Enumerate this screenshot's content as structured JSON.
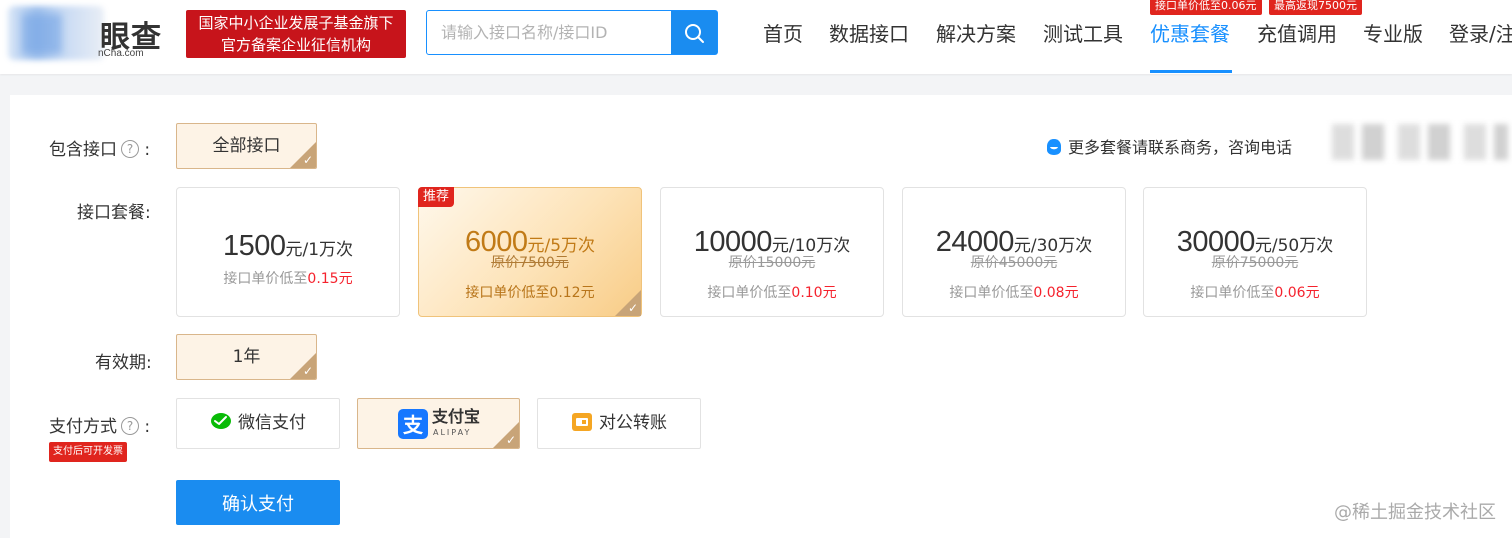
{
  "header": {
    "logo": {
      "name": "眼查",
      "domain": "nCha.com"
    },
    "gov_badge": {
      "line1": "国家中小企业发展子基金旗下",
      "line2": "官方备案企业征信机构"
    },
    "search": {
      "placeholder": "请输入接口名称/接口ID",
      "value": ""
    },
    "nav": [
      {
        "label": "首页"
      },
      {
        "label": "数据接口"
      },
      {
        "label": "解决方案"
      },
      {
        "label": "测试工具"
      },
      {
        "label": "优惠套餐",
        "active": true
      },
      {
        "label": "充值调用"
      },
      {
        "label": "专业版"
      },
      {
        "label": "登录/注"
      }
    ],
    "nav_tags": [
      "接口单价低至0.06元",
      "最高返现7500元"
    ],
    "accent_color": "#1890ff"
  },
  "main": {
    "include_label": "包含接口",
    "include_option": "全部接口",
    "contact_text": "更多套餐请联系商务，咨询电话",
    "package_label": "接口套餐:",
    "packages": [
      {
        "price": "1500",
        "suffix": "元/1万次",
        "original": "",
        "unit_prefix": "接口单价低至",
        "unit_price": "0.15元",
        "selected": false
      },
      {
        "price": "6000",
        "suffix": "元/5万次",
        "original": "原价7500元",
        "unit_prefix": "接口单价低至",
        "unit_price": "0.12元",
        "selected": true,
        "tag": "推荐"
      },
      {
        "price": "10000",
        "suffix": "元/10万次",
        "original": "原价15000元",
        "unit_prefix": "接口单价低至",
        "unit_price": "0.10元",
        "selected": false
      },
      {
        "price": "24000",
        "suffix": "元/30万次",
        "original": "原价45000元",
        "unit_prefix": "接口单价低至",
        "unit_price": "0.08元",
        "selected": false
      },
      {
        "price": "30000",
        "suffix": "元/50万次",
        "original": "原价75000元",
        "unit_prefix": "接口单价低至",
        "unit_price": "0.06元",
        "selected": false
      }
    ],
    "validity_label": "有效期:",
    "validity_option": "1年",
    "payment_label": "支付方式",
    "payment_badge": "支付后可开发票",
    "payments": [
      {
        "label": "微信支付",
        "icon": "wechat-pay-icon"
      },
      {
        "label": "支付宝",
        "sub": "ALIPAY",
        "icon": "alipay-icon",
        "selected": true
      },
      {
        "label": "对公转账",
        "icon": "bank-transfer-icon"
      }
    ],
    "confirm_label": "确认支付",
    "help_glyph": "?",
    "colon": ":"
  },
  "watermark": "@稀土掘金技术社区"
}
